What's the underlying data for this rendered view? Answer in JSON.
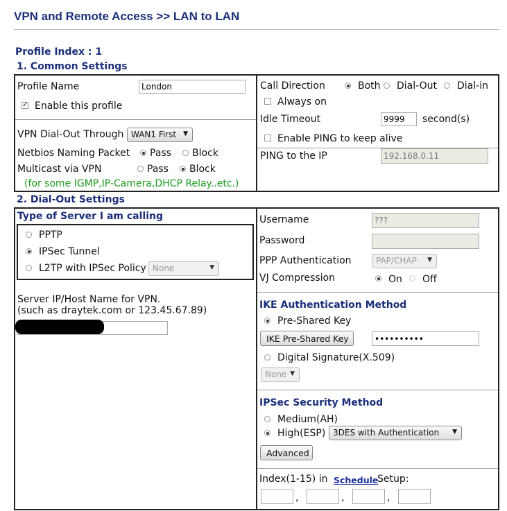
{
  "page": {
    "title": "VPN and Remote Access >> LAN to LAN"
  },
  "profile_index": {
    "label": "Profile Index : 1"
  },
  "common": {
    "heading": "1. Common Settings",
    "profile_name_label": "Profile Name",
    "profile_name_value": "London",
    "enable_label": "Enable this profile",
    "enable_checked": true,
    "dialout_through_label": "VPN Dial-Out Through",
    "dialout_through_value": "WAN1 First",
    "netbios_label": "Netbios Naming Packet",
    "netbios_options": [
      "Pass",
      "Block"
    ],
    "netbios_selected": "Pass",
    "multicast_label": "Multicast via VPN",
    "multicast_options": [
      "Pass",
      "Block"
    ],
    "multicast_selected": "Block",
    "multicast_note": "(for some IGMP,IP-Camera,DHCP Relay..etc.)",
    "call_direction_label": "Call Direction",
    "call_direction_options": [
      "Both",
      "Dial-Out",
      "Dial-in"
    ],
    "call_direction_selected": "Both",
    "always_on_label": "Always on",
    "idle_timeout_label": "Idle Timeout",
    "idle_timeout_value": "9999",
    "idle_timeout_unit": "second(s)",
    "ping_keepalive_label": "Enable PING to keep alive",
    "ping_ip_label": "PING to the IP",
    "ping_ip_value": "192.168.0.11"
  },
  "dialout": {
    "heading": "2. Dial-Out Settings",
    "server_type_heading": "Type of Server I am calling",
    "server_types": [
      "PPTP",
      "IPSec Tunnel",
      "L2TP with IPSec Policy"
    ],
    "server_type_selected": "IPSec Tunnel",
    "l2tp_policy_value": "None",
    "server_ip_label": "Server IP/Host Name for VPN.",
    "server_ip_hint": "(such as draytek.com or 123.45.67.89)",
    "username_label": "Username",
    "username_value": "???",
    "password_label": "Password",
    "ppp_auth_label": "PPP Authentication",
    "ppp_auth_value": "PAP/CHAP",
    "vj_label": "VJ Compression",
    "vj_options": [
      "On",
      "Off"
    ],
    "vj_selected": "On",
    "ike_heading": "IKE Authentication Method",
    "preshared_label": "Pre-Shared Key",
    "ike_key_button": "IKE Pre-Shared Key",
    "ike_key_value": "••••••••••",
    "digital_sig_label": "Digital Signature(X.509)",
    "digital_sig_value": "None",
    "ipsec_heading": "IPSec Security Method",
    "medium_label": "Medium(AH)",
    "high_label": "High(ESP)",
    "ipsec_selected": "High(ESP)",
    "esp_value": "3DES with Authentication",
    "advanced_button": "Advanced",
    "index_prefix": "Index(1-15) in",
    "schedule_link": "Schedule",
    "index_suffix": "Setup:",
    "schedule_slots": [
      "",
      "",
      "",
      ""
    ],
    "slot_separator": ","
  }
}
